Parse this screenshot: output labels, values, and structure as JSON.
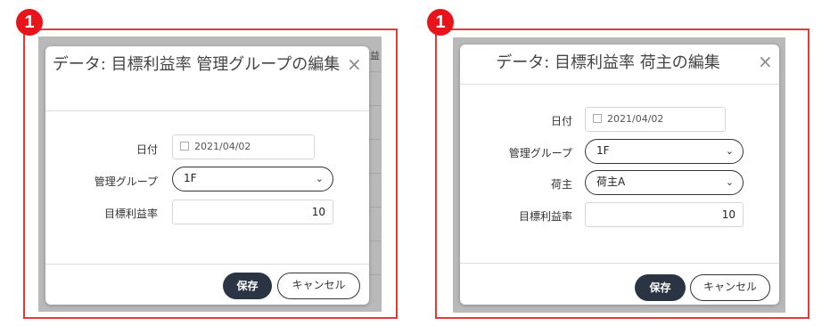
{
  "badge": "1",
  "left_dialog": {
    "background_text": "益",
    "title": "データ: 目標利益率 管理グループの編集",
    "close_icon": "×",
    "date_label": "日付",
    "date_value": "2021/04/02",
    "group_label": "管理グループ",
    "group_value": "1F",
    "rate_label": "目標利益率",
    "rate_value": "10",
    "save_label": "保存",
    "cancel_label": "キャンセル"
  },
  "right_dialog": {
    "title": "データ: 目標利益率 荷主の編集",
    "close_icon": "×",
    "date_label": "日付",
    "date_value": "2021/04/02",
    "group_label": "管理グループ",
    "group_value": "1F",
    "shipper_label": "荷主",
    "shipper_value": "荷主A",
    "rate_label": "目標利益率",
    "rate_value": "10",
    "save_label": "保存",
    "cancel_label": "キャンセル"
  },
  "colors": {
    "highlight": "#e03a3a",
    "badge": "#e8141c",
    "save_button": "#2b3442"
  }
}
